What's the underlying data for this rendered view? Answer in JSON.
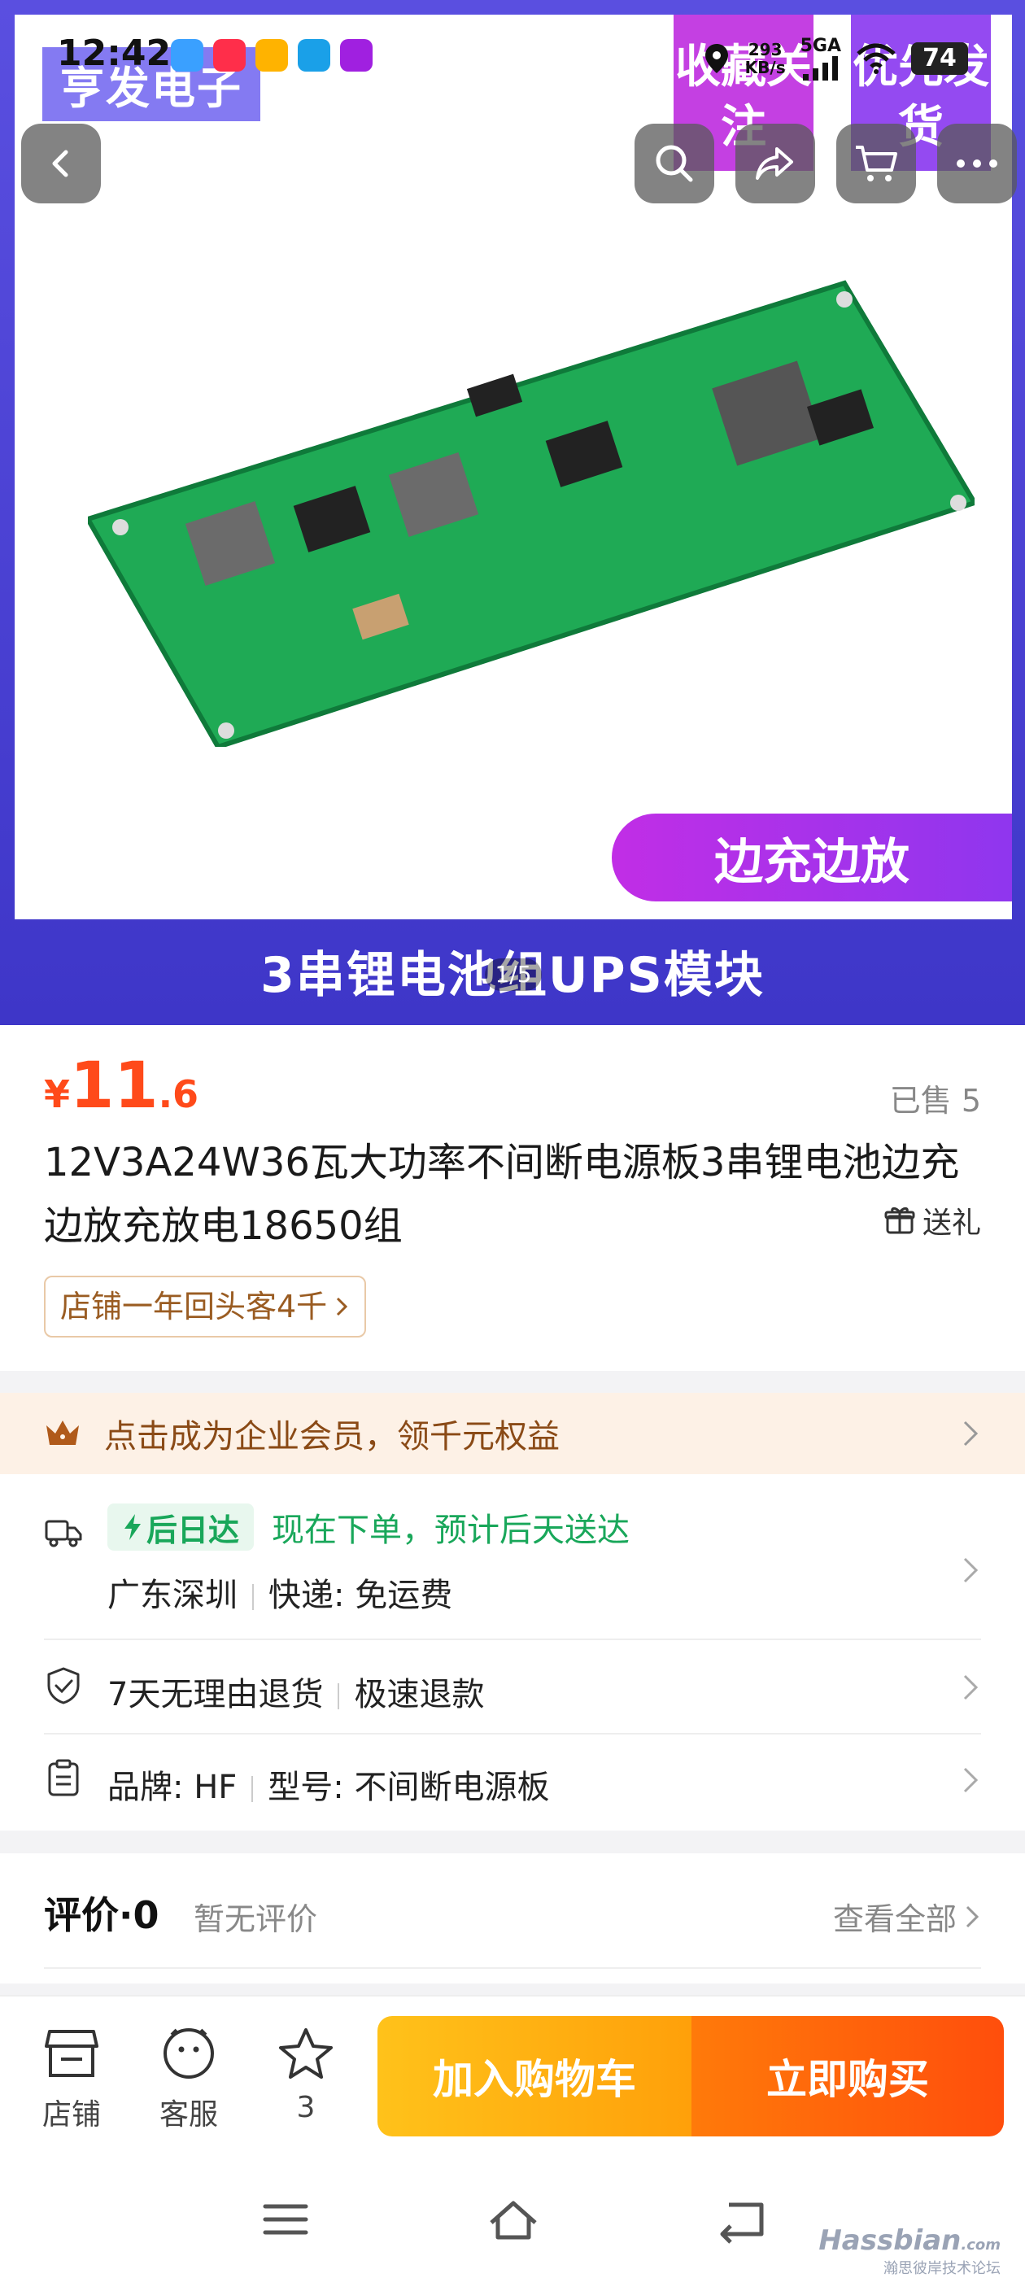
{
  "status_bar": {
    "time": "12:42",
    "speed_value": "293",
    "speed_unit": "KB/s",
    "network": "5GA",
    "battery": "74"
  },
  "hero": {
    "watermark": "亨发电子",
    "corner_left": "收藏关注",
    "corner_right": "优先发货",
    "promo": "边充边放",
    "caption": "3串锂电池组UPS模块",
    "counter": "1/5"
  },
  "product": {
    "price_currency": "¥",
    "price_integer": "11",
    "price_decimal": ".6",
    "sold": "已售 5",
    "title": "12V3A24W36瓦大功率不间断电源板3串锂电池边充边放充放电18650组",
    "gift": "送礼",
    "shop_tag": "店铺一年回头客4千"
  },
  "member_strip": {
    "text": "点击成为企业会员，领千元权益"
  },
  "delivery": {
    "badge": "后日达",
    "promise": "现在下单，预计后天送达",
    "origin": "广东深圳",
    "shipping": "快递: 免运费"
  },
  "returns": {
    "policy": "7天无理由退货",
    "refund": "极速退款"
  },
  "specs": {
    "brand": "品牌: HF",
    "model": "型号: 不间断电源板"
  },
  "reviews": {
    "title": "评价·0",
    "empty": "暂无评价",
    "view_all": "查看全部"
  },
  "action_bar": {
    "shop": "店铺",
    "service": "客服",
    "favorites": "3",
    "add_to_cart": "加入购物车",
    "buy_now": "立即购买"
  },
  "watermark": {
    "brand": "Hassbian",
    "domain": ".com",
    "subtitle": "瀚思彼岸技术论坛"
  },
  "colors": {
    "price": "#ff4a1a",
    "delivery_green": "#19a75a",
    "member_text": "#8a4a16",
    "cart_button": "#ffb00f",
    "buy_button": "#ff5a0c",
    "hero_band": "#4a41d6"
  },
  "icons": {
    "back": "chevron-left-icon",
    "search": "search-icon",
    "share": "share-icon",
    "cart": "cart-icon",
    "more": "more-icon",
    "gift": "gift-icon",
    "crown": "crown-icon",
    "truck": "truck-icon",
    "shield": "shield-check-icon",
    "clipboard": "clipboard-icon",
    "store": "store-icon",
    "service": "chat-face-icon",
    "star": "star-icon"
  }
}
